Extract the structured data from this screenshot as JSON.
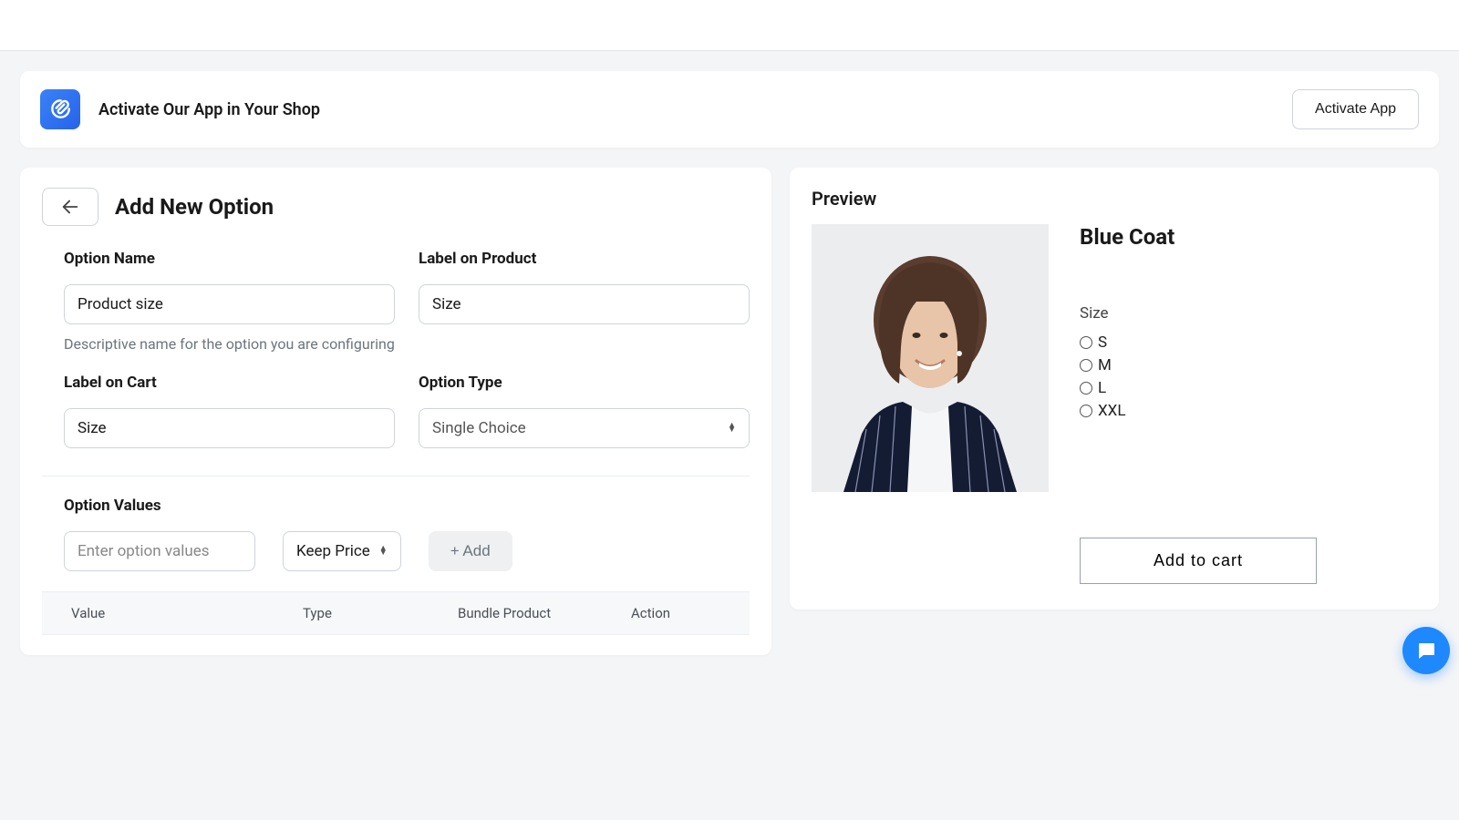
{
  "banner": {
    "title": "Activate Our App in Your Shop",
    "activate_label": "Activate App"
  },
  "form": {
    "page_title": "Add New Option",
    "option_name": {
      "label": "Option Name",
      "value": "Product size",
      "help": "Descriptive name for the option you are configuring"
    },
    "label_on_product": {
      "label": "Label on Product",
      "value": "Size"
    },
    "label_on_cart": {
      "label": "Label on Cart",
      "value": "Size"
    },
    "option_type": {
      "label": "Option Type",
      "value": "Single Choice"
    },
    "option_values": {
      "title": "Option Values",
      "input_placeholder": "Enter option values",
      "price_select": "Keep Price",
      "add_label": "+ Add",
      "columns": {
        "value": "Value",
        "type": "Type",
        "bundle": "Bundle Product",
        "action": "Action"
      }
    }
  },
  "preview": {
    "title": "Preview",
    "product_name": "Blue Coat",
    "option_label": "Size",
    "options": [
      "S",
      "M",
      "L",
      "XXL"
    ],
    "add_to_cart": "Add to cart"
  }
}
